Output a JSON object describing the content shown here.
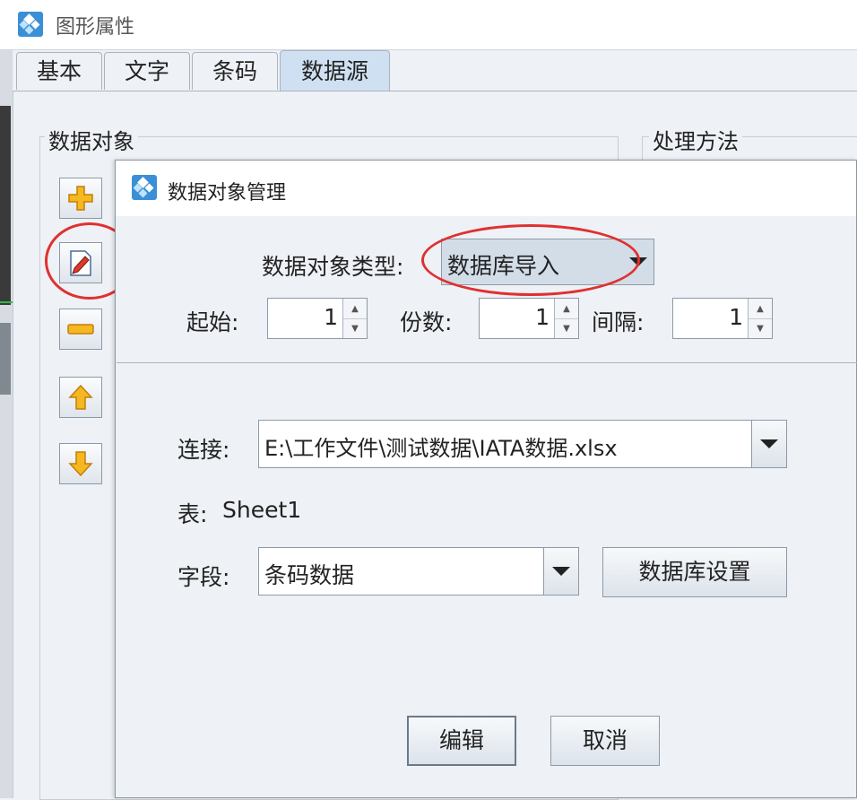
{
  "window": {
    "title": "图形属性"
  },
  "tabs": [
    "基本",
    "文字",
    "条码",
    "数据源"
  ],
  "active_tab": "数据源",
  "groups": {
    "data_object": "数据对象",
    "processing": "处理方法"
  },
  "side_buttons": [
    "add-icon",
    "edit-icon",
    "remove-icon",
    "move-up-icon",
    "move-down-icon"
  ],
  "dialog": {
    "title": "数据对象管理",
    "type_label": "数据对象类型:",
    "type_value": "数据库导入",
    "start_label": "起始:",
    "start_value": "1",
    "copies_label": "份数:",
    "copies_value": "1",
    "interval_label": "间隔:",
    "interval_value": "1",
    "connection_label": "连接:",
    "connection_value": "E:\\工作文件\\测试数据\\IATA数据.xlsx",
    "table_label": "表:",
    "table_value": "Sheet1",
    "field_label": "字段:",
    "field_value": "条码数据",
    "db_settings_button": "数据库设置",
    "edit_button": "编辑",
    "cancel_button": "取消"
  },
  "colors": {
    "highlight_circle": "#e03030",
    "active_tab": "#cfe0f2",
    "icon_orange": "#f5b820"
  }
}
